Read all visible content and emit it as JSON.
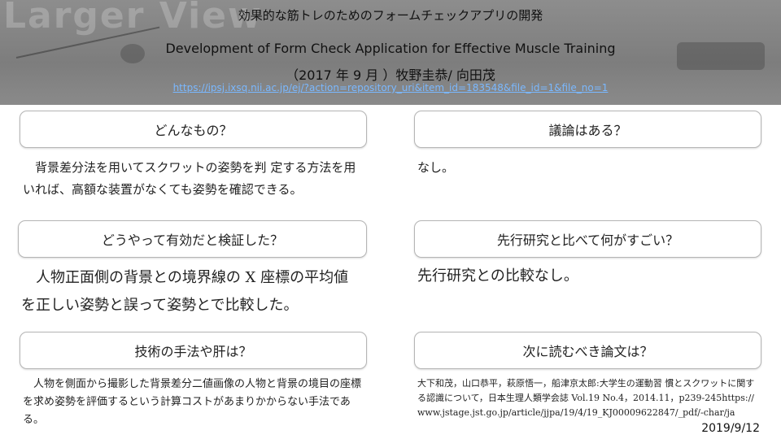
{
  "header": {
    "bg_watermark": "Larger View",
    "title_jp": "効果的な筋トレのためのフォームチェックアプリの開発",
    "title_en": "Development of Form Check Application for Effective Muscle Training",
    "date_authors": "（2017 年 9 月 ）牧野圭恭/ 向田茂",
    "url": "https://ipsj.ixsq.nii.ac.jp/ej/?action=repository_uri&item_id=183548&file_id=1&file_no=1"
  },
  "sections": {
    "what": {
      "question": "どんなもの？",
      "answer": "背景差分法を用いてスクワットの姿勢を判 定する方法を用いれば、高額な装置がなくても姿勢を確認できる。"
    },
    "how_verified": {
      "question": "どうやって有効だと検証した？",
      "answer": "人物正面側の背景との境界線の X 座標の平均値を正しい姿勢と誤って姿勢とで比較した。"
    },
    "technique": {
      "question": "技術の手法や肝は？",
      "answer": "人物を側面から撮影した背景差分二値画像の人物と背景の境目の座標を求め姿勢を評価するという計算コストがあまりかからない手法である。"
    },
    "discussion": {
      "question": "議論はある？",
      "answer": "なし。"
    },
    "vs_prior": {
      "question": "先行研究と比べて何がすごい？",
      "answer": "先行研究との比較なし。"
    },
    "next_paper": {
      "question": "次に読むべき論文は？",
      "answer": "大下和茂，山口恭平，萩原悟一，船津京太郎:大学生の運動習 慣とスクワットに関する認識について，日本生理人類学会誌 Vol.19 No.4，2014.11，p239-245https://www.jstage.jst.go.jp/article/jjpa/19/4/19_KJ00009622847/_pdf/-char/ja"
    }
  },
  "footer": {
    "date": "2019/9/12"
  }
}
